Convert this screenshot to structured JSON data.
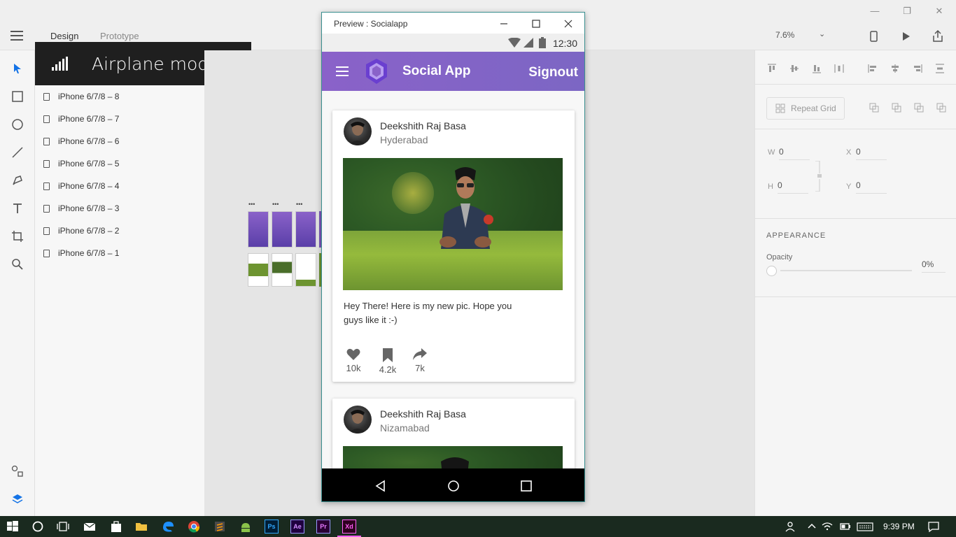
{
  "window": {
    "title_controls": [
      "minimize",
      "restore",
      "close"
    ]
  },
  "toolbar": {
    "tabs": [
      {
        "label": "Design"
      },
      {
        "label": "Prototype"
      }
    ],
    "zoom": "7.6%"
  },
  "notification": {
    "text": "Airplane mode off"
  },
  "layers": {
    "items": [
      {
        "label": "iPhone 6/7/8 – 8"
      },
      {
        "label": "iPhone 6/7/8 – 7"
      },
      {
        "label": "iPhone 6/7/8 – 6"
      },
      {
        "label": "iPhone 6/7/8 – 5"
      },
      {
        "label": "iPhone 6/7/8 – 4"
      },
      {
        "label": "iPhone 6/7/8 – 3"
      },
      {
        "label": "iPhone 6/7/8 – 2"
      },
      {
        "label": "iPhone 6/7/8 – 1"
      }
    ]
  },
  "properties": {
    "repeat_grid": "Repeat Grid",
    "w_label": "W",
    "w_value": "0",
    "h_label": "H",
    "h_value": "0",
    "x_label": "X",
    "x_value": "0",
    "y_label": "Y",
    "y_value": "0",
    "appearance": "APPEARANCE",
    "opacity_label": "Opacity",
    "opacity_value": "0%"
  },
  "preview": {
    "title": "Preview : Socialapp",
    "status_time": "12:30",
    "app_title": "Social App",
    "signout": "Signout",
    "posts": [
      {
        "name": "Deekshith Raj Basa",
        "location": "Hyderabad",
        "caption": "Hey There! Here is my new pic. Hope you guys like it :-)",
        "likes": "10k",
        "saves": "4.2k",
        "shares": "7k"
      },
      {
        "name": "Deekshith Raj Basa",
        "location": "Nizamabad"
      }
    ]
  },
  "taskbar": {
    "apps": [
      "start",
      "cortana",
      "task-view",
      "mail",
      "store",
      "file-explorer",
      "edge",
      "chrome",
      "sublime",
      "android-studio",
      "Ps",
      "Ae",
      "Pr",
      "Xd"
    ],
    "clock": "9:39 PM"
  },
  "colors": {
    "app_bar_start": "#8a62c9",
    "app_bar_end": "#7c66c4",
    "xd_accent": "#ff26be"
  }
}
